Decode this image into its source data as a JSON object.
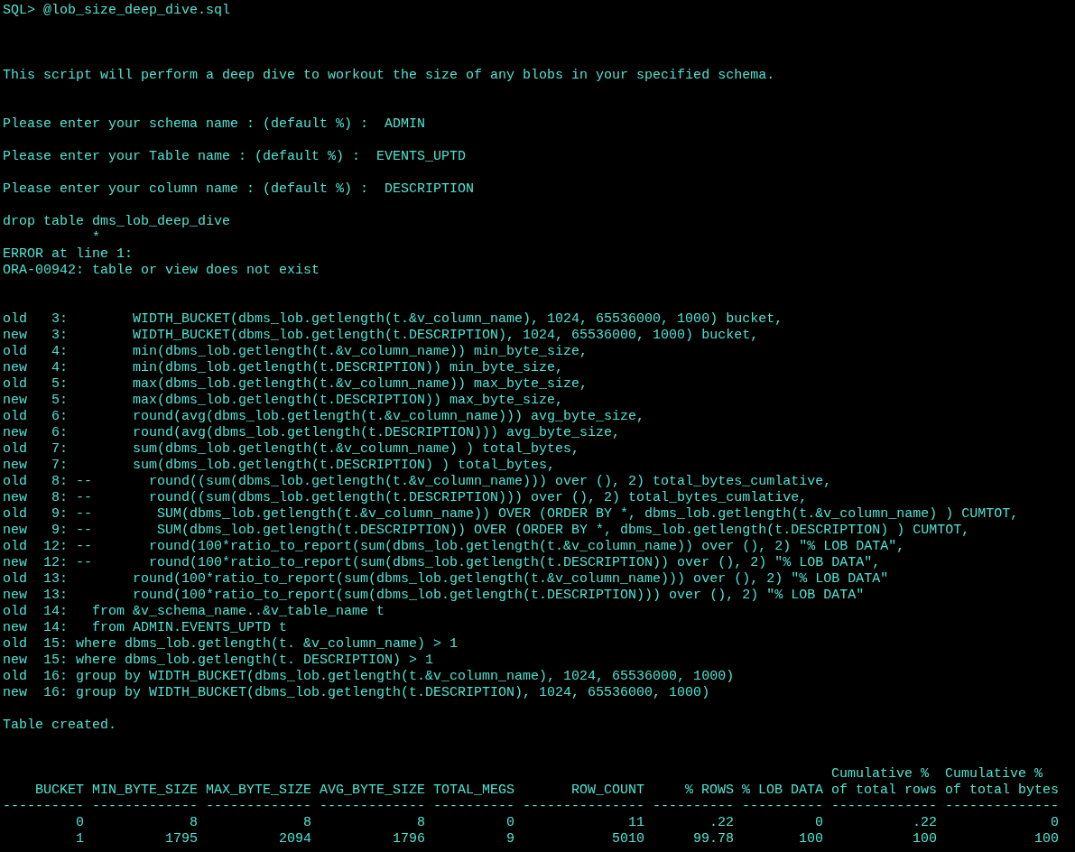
{
  "terminal": {
    "lines": [
      {
        "kind": "text",
        "text": "SQL> @lob_size_deep_dive.sql"
      },
      {
        "kind": "blank"
      },
      {
        "kind": "blank"
      },
      {
        "kind": "blank"
      },
      {
        "kind": "text",
        "text": "This script will perform a deep dive to workout the size of any blobs in your specified schema."
      },
      {
        "kind": "blank"
      },
      {
        "kind": "blank"
      },
      {
        "kind": "text",
        "text": "Please enter your schema name : (default %) :  ADMIN"
      },
      {
        "kind": "blank"
      },
      {
        "kind": "text",
        "text": "Please enter your Table name : (default %) :  EVENTS_UPTD"
      },
      {
        "kind": "blank"
      },
      {
        "kind": "text",
        "text": "Please enter your column name : (default %) :  DESCRIPTION"
      },
      {
        "kind": "blank"
      },
      {
        "kind": "text",
        "text": "drop table dms_lob_deep_dive"
      },
      {
        "kind": "text",
        "text": "           *"
      },
      {
        "kind": "text",
        "text": "ERROR at line 1:"
      },
      {
        "kind": "text",
        "text": "ORA-00942: table or view does not exist"
      },
      {
        "kind": "blank"
      },
      {
        "kind": "blank"
      },
      {
        "kind": "text",
        "text": "old   3:        WIDTH_BUCKET(dbms_lob.getlength(t.&v_column_name), 1024, 65536000, 1000) bucket,"
      },
      {
        "kind": "text",
        "text": "new   3:        WIDTH_BUCKET(dbms_lob.getlength(t.DESCRIPTION), 1024, 65536000, 1000) bucket,"
      },
      {
        "kind": "text",
        "text": "old   4:        min(dbms_lob.getlength(t.&v_column_name)) min_byte_size,"
      },
      {
        "kind": "text",
        "text": "new   4:        min(dbms_lob.getlength(t.DESCRIPTION)) min_byte_size,"
      },
      {
        "kind": "text",
        "text": "old   5:        max(dbms_lob.getlength(t.&v_column_name)) max_byte_size,"
      },
      {
        "kind": "text",
        "text": "new   5:        max(dbms_lob.getlength(t.DESCRIPTION)) max_byte_size,"
      },
      {
        "kind": "text",
        "text": "old   6:        round(avg(dbms_lob.getlength(t.&v_column_name))) avg_byte_size,"
      },
      {
        "kind": "text",
        "text": "new   6:        round(avg(dbms_lob.getlength(t.DESCRIPTION))) avg_byte_size,"
      },
      {
        "kind": "text",
        "text": "old   7:        sum(dbms_lob.getlength(t.&v_column_name) ) total_bytes,"
      },
      {
        "kind": "text",
        "text": "new   7:        sum(dbms_lob.getlength(t.DESCRIPTION) ) total_bytes,"
      },
      {
        "kind": "text",
        "text": "old   8: --       round((sum(dbms_lob.getlength(t.&v_column_name))) over (), 2) total_bytes_cumlative,"
      },
      {
        "kind": "text",
        "text": "new   8: --       round((sum(dbms_lob.getlength(t.DESCRIPTION))) over (), 2) total_bytes_cumlative,"
      },
      {
        "kind": "text",
        "text": "old   9: --        SUM(dbms_lob.getlength(t.&v_column_name)) OVER (ORDER BY *, dbms_lob.getlength(t.&v_column_name) ) CUMTOT,"
      },
      {
        "kind": "text",
        "text": "new   9: --        SUM(dbms_lob.getlength(t.DESCRIPTION)) OVER (ORDER BY *, dbms_lob.getlength(t.DESCRIPTION) ) CUMTOT,"
      },
      {
        "kind": "text",
        "text": "old  12: --       round(100*ratio_to_report(sum(dbms_lob.getlength(t.&v_column_name)) over (), 2) \"% LOB DATA\","
      },
      {
        "kind": "text",
        "text": "new  12: --       round(100*ratio_to_report(sum(dbms_lob.getlength(t.DESCRIPTION)) over (), 2) \"% LOB DATA\","
      },
      {
        "kind": "text",
        "text": "old  13:        round(100*ratio_to_report(sum(dbms_lob.getlength(t.&v_column_name))) over (), 2) \"% LOB DATA\""
      },
      {
        "kind": "text",
        "text": "new  13:        round(100*ratio_to_report(sum(dbms_lob.getlength(t.DESCRIPTION))) over (), 2) \"% LOB DATA\""
      },
      {
        "kind": "text",
        "text": "old  14:   from &v_schema_name..&v_table_name t"
      },
      {
        "kind": "text",
        "text": "new  14:   from ADMIN.EVENTS_UPTD t"
      },
      {
        "kind": "text",
        "text": "old  15: where dbms_lob.getlength(t. &v_column_name) > 1"
      },
      {
        "kind": "text",
        "text": "new  15: where dbms_lob.getlength(t. DESCRIPTION) > 1"
      },
      {
        "kind": "text",
        "text": "old  16: group by WIDTH_BUCKET(dbms_lob.getlength(t.&v_column_name), 1024, 65536000, 1000)"
      },
      {
        "kind": "text",
        "text": "new  16: group by WIDTH_BUCKET(dbms_lob.getlength(t.DESCRIPTION), 1024, 65536000, 1000)"
      },
      {
        "kind": "blank"
      },
      {
        "kind": "text",
        "text": "Table created."
      },
      {
        "kind": "blank"
      },
      {
        "kind": "blank"
      }
    ],
    "table": {
      "columns": [
        {
          "heading": [
            "BUCKET"
          ],
          "rule": "----------"
        },
        {
          "heading": [
            "MIN_BYTE_SIZE"
          ],
          "rule": "-------------"
        },
        {
          "heading": [
            "MAX_BYTE_SIZE"
          ],
          "rule": "-------------"
        },
        {
          "heading": [
            "AVG_BYTE_SIZE"
          ],
          "rule": "-------------"
        },
        {
          "heading": [
            "TOTAL_MEGS"
          ],
          "rule": "----------"
        },
        {
          "heading": [
            "ROW_COUNT"
          ],
          "rule": "---------------"
        },
        {
          "heading": [
            "% ROWS"
          ],
          "rule": "----------"
        },
        {
          "heading": [
            "% LOB DATA"
          ],
          "rule": "----------"
        },
        {
          "heading": [
            "Cumulative %",
            "of total rows"
          ],
          "rule": "-------------"
        },
        {
          "heading": [
            "Cumulative %",
            "of total bytes"
          ],
          "rule": "--------------"
        }
      ],
      "rows": [
        [
          "0",
          "8",
          "8",
          "8",
          "0",
          "11",
          ".22",
          "0",
          ".22",
          "0"
        ],
        [
          "1",
          "1795",
          "2094",
          "1796",
          "9",
          "5010",
          "99.78",
          "100",
          "100",
          "100"
        ]
      ]
    }
  }
}
